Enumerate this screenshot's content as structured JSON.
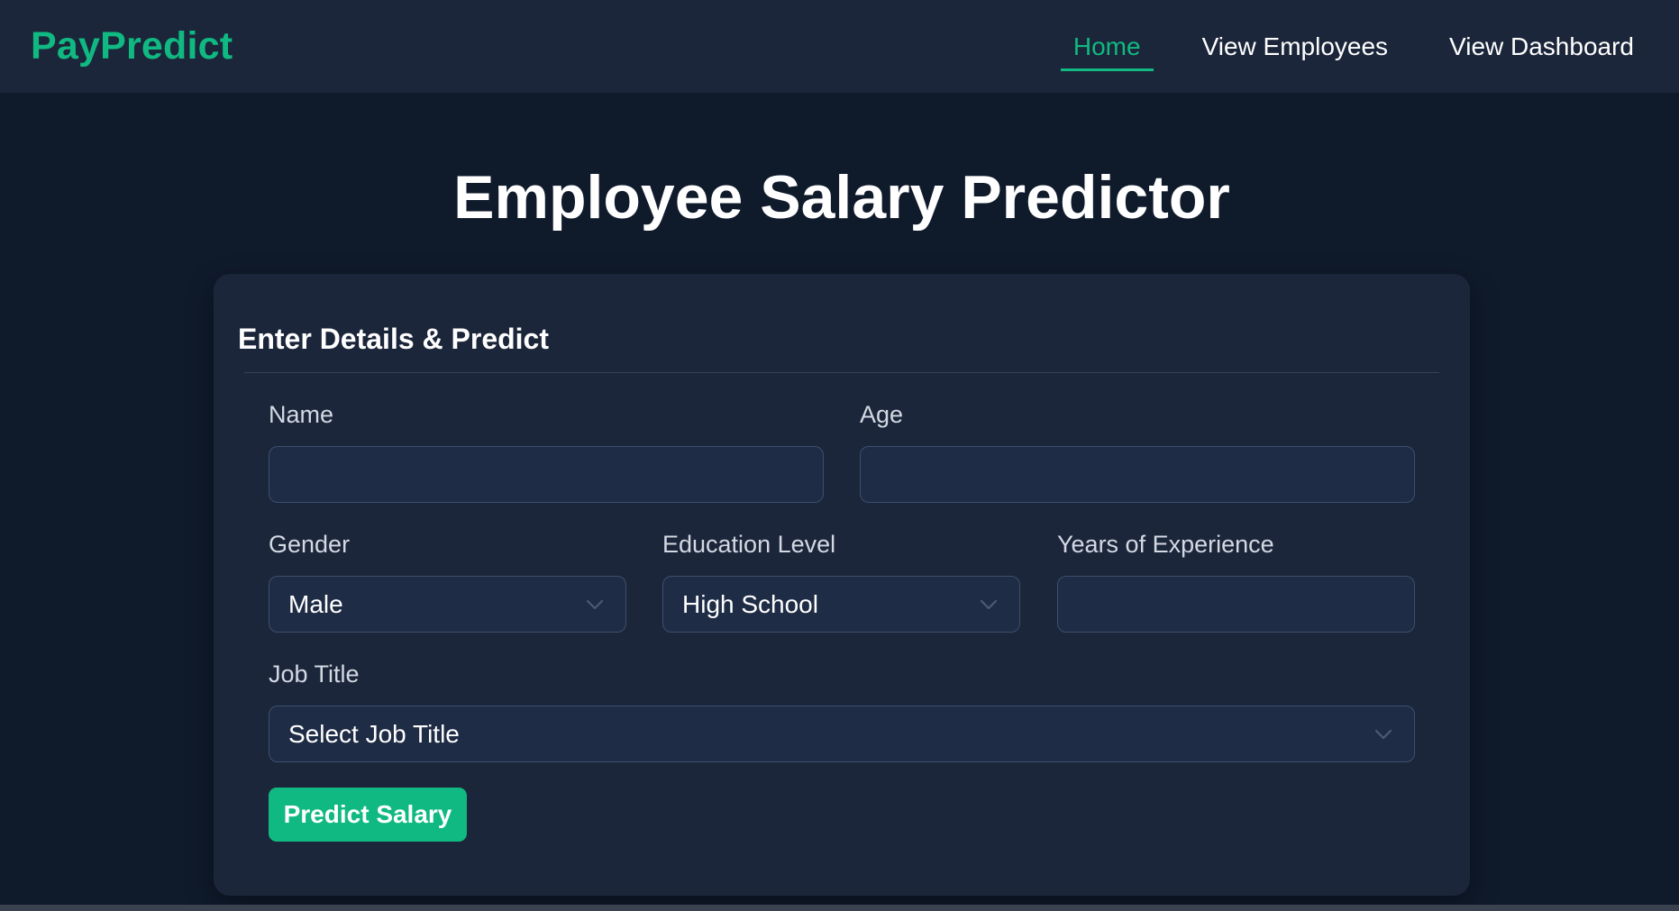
{
  "navbar": {
    "brand": "PayPredict",
    "links": [
      {
        "label": "Home",
        "active": true
      },
      {
        "label": "View Employees",
        "active": false
      },
      {
        "label": "View Dashboard",
        "active": false
      }
    ]
  },
  "main": {
    "title": "Employee Salary Predictor"
  },
  "form": {
    "heading": "Enter Details & Predict",
    "name": {
      "label": "Name",
      "value": "",
      "placeholder": ""
    },
    "age": {
      "label": "Age",
      "value": "",
      "placeholder": ""
    },
    "gender": {
      "label": "Gender",
      "selected": "Male"
    },
    "education": {
      "label": "Education Level",
      "selected": "High School"
    },
    "experience": {
      "label": "Years of Experience",
      "value": "",
      "placeholder": ""
    },
    "job_title": {
      "label": "Job Title",
      "selected": "Select Job Title"
    },
    "submit_label": "Predict Salary"
  },
  "colors": {
    "accent": "#10b981",
    "background": "#0f1a2b",
    "panel": "#1c263a",
    "input_bg": "#1f2c45",
    "input_border": "#3d4e6d"
  },
  "icons": {
    "select_arrow": "chevron-down-icon"
  }
}
